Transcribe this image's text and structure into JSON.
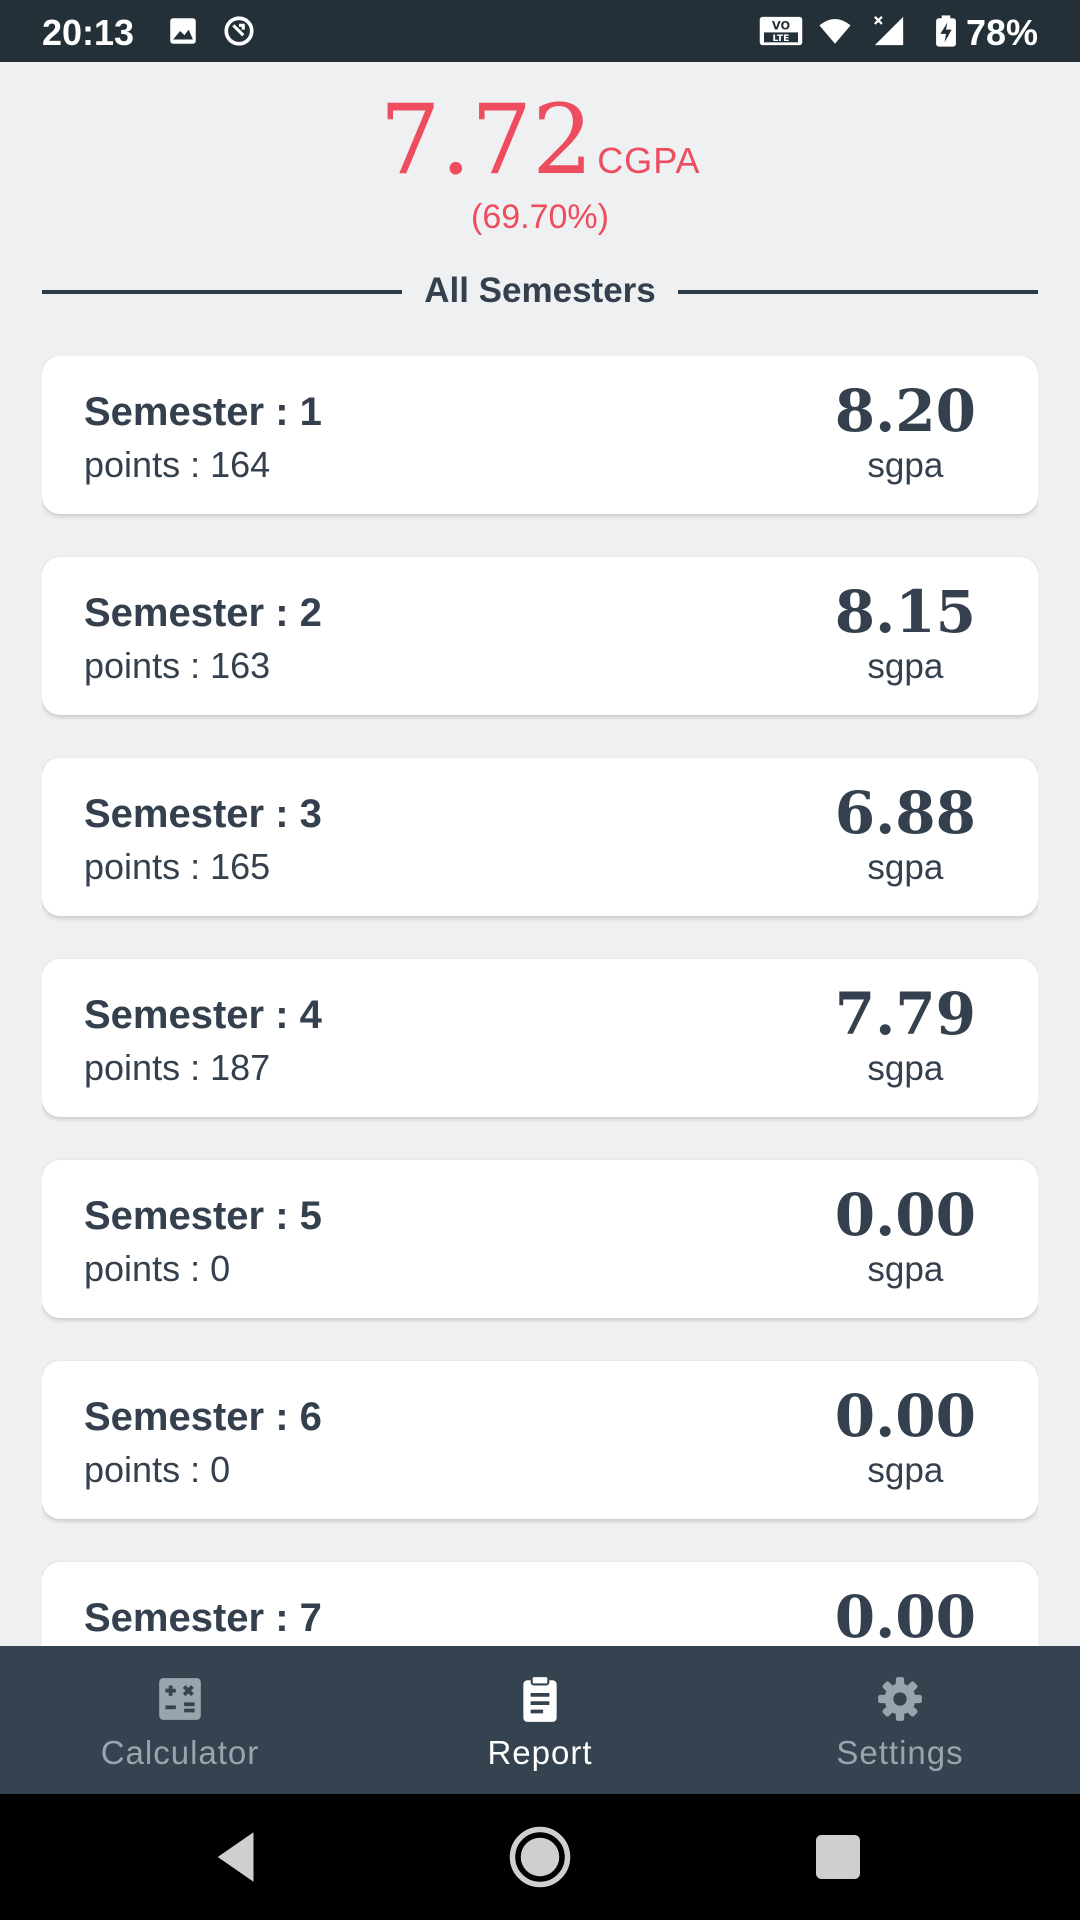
{
  "status_bar": {
    "time": "20:13",
    "battery": "78%",
    "icons": [
      "image-icon",
      "data-saver-icon",
      "volte-icon",
      "wifi-icon",
      "signal-icon",
      "battery-charging-icon"
    ]
  },
  "header": {
    "cgpa_value": "7.72",
    "cgpa_label": "CGPA",
    "percentage": "(69.70%)",
    "section_title": "All Semesters"
  },
  "semesters": [
    {
      "title": "Semester : 1",
      "points": "points : 164",
      "sgpa": "8.20",
      "unit": "sgpa"
    },
    {
      "title": "Semester : 2",
      "points": "points : 163",
      "sgpa": "8.15",
      "unit": "sgpa"
    },
    {
      "title": "Semester : 3",
      "points": "points : 165",
      "sgpa": "6.88",
      "unit": "sgpa"
    },
    {
      "title": "Semester : 4",
      "points": "points : 187",
      "sgpa": "7.79",
      "unit": "sgpa"
    },
    {
      "title": "Semester : 5",
      "points": "points : 0",
      "sgpa": "0.00",
      "unit": "sgpa"
    },
    {
      "title": "Semester : 6",
      "points": "points : 0",
      "sgpa": "0.00",
      "unit": "sgpa"
    },
    {
      "title": "Semester : 7",
      "points": "",
      "sgpa": "0.00",
      "unit": ""
    }
  ],
  "bottom_nav": {
    "items": [
      {
        "label": "Calculator",
        "icon": "calculator-icon",
        "active": false
      },
      {
        "label": "Report",
        "icon": "report-icon",
        "active": true
      },
      {
        "label": "Settings",
        "icon": "settings-icon",
        "active": false
      }
    ]
  },
  "colors": {
    "accent": "#ee4c5f",
    "text": "#34404d",
    "nav_bg": "#34434f",
    "status_bg": "#243038",
    "page_bg": "#eff0f2"
  }
}
